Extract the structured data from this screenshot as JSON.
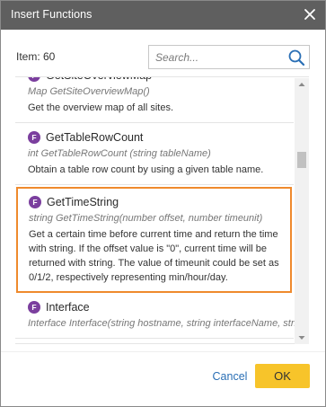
{
  "dialog": {
    "title": "Insert Functions",
    "item_count": "Item: 60"
  },
  "search": {
    "placeholder": "Search...",
    "value": ""
  },
  "functions": [
    {
      "badge": "F",
      "name": "GetSiteOverviewMap",
      "signature": "Map GetSiteOverviewMap()",
      "description": "Get the overview map of all sites."
    },
    {
      "badge": "F",
      "name": "GetTableRowCount",
      "signature": "int GetTableRowCount (string tableName)",
      "description": "Obtain a table row count by using a given table name."
    },
    {
      "badge": "F",
      "name": "GetTimeString",
      "signature": "string GetTimeString(number offset, number timeunit)",
      "description": "Get a certain time before current time and return the time with string. If the offset value is \"0\", current time will be returned with string. The value of timeunit could be set as 0/1/2, respectively representing min/hour/day.",
      "selected": true
    },
    {
      "badge": "F",
      "name": "Interface",
      "signature": "Interface Interface(string hostname, string interfaceName, string interfaceType = \"Interface\")",
      "description": ""
    }
  ],
  "scrollbar": {
    "position_fraction": 0.27
  },
  "buttons": {
    "cancel": "Cancel",
    "ok": "OK"
  },
  "colors": {
    "titlebar": "#5f5f5f",
    "selection_border": "#ef8a2d",
    "badge": "#7b3f9e",
    "ok_button": "#f7c42a",
    "link": "#2a6fb5"
  },
  "icons": {
    "close": "close-icon",
    "search": "search-icon",
    "function": "function-icon"
  }
}
